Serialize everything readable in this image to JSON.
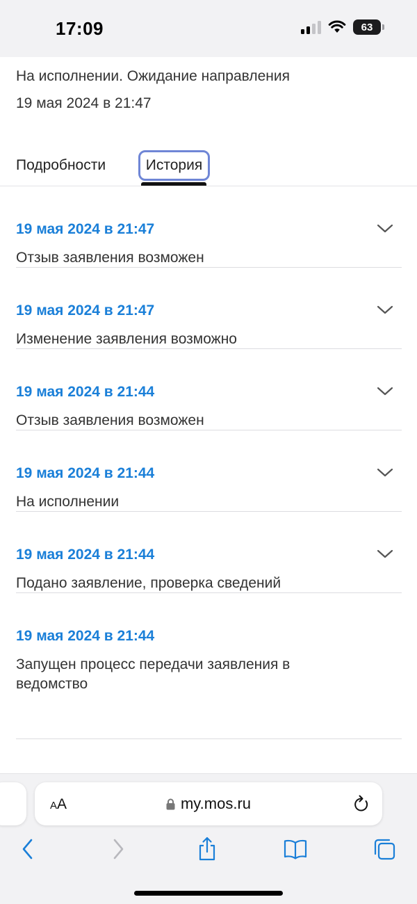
{
  "status_bar": {
    "time": "17:09",
    "battery_level": "63",
    "icons": [
      "signal-icon",
      "wifi-icon",
      "battery-icon"
    ]
  },
  "application": {
    "status_text": "На исполнении. Ожидание направления",
    "status_date": "19 мая 2024 в 21:47"
  },
  "tabs": {
    "details_label": "Подробности",
    "history_label": "История",
    "active": "История"
  },
  "history": [
    {
      "date": "19 мая 2024 в 21:47",
      "text": "Отзыв заявления возможен",
      "expandable": true
    },
    {
      "date": "19 мая 2024 в 21:47",
      "text": "Изменение заявления возможно",
      "expandable": true
    },
    {
      "date": "19 мая 2024 в 21:44",
      "text": "Отзыв заявления возможен",
      "expandable": true
    },
    {
      "date": "19 мая 2024 в 21:44",
      "text": "На исполнении",
      "expandable": true
    },
    {
      "date": "19 мая 2024 в 21:44",
      "text": "Подано заявление, проверка сведений",
      "expandable": true
    },
    {
      "date": "19 мая 2024 в 21:44",
      "text": "Запущен процесс передачи заявления в ведомство",
      "expandable": false
    }
  ],
  "browser": {
    "text_size_label": "AA",
    "url": "my.mos.ru",
    "toolbar_icons": [
      "back-icon",
      "forward-icon",
      "share-icon",
      "bookmarks-icon",
      "tabs-icon"
    ]
  },
  "colors": {
    "accent": "#1a7fd8",
    "focus_ring": "#6f86d6",
    "background": "#ffffff",
    "chrome": "#f2f2f4"
  }
}
